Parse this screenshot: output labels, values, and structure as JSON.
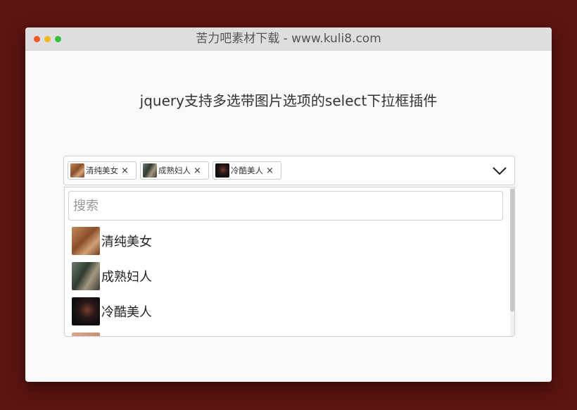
{
  "window": {
    "title": "苦力吧素材下载 - www.kuli8.com",
    "traffic_lights": {
      "close": "#f0592a",
      "minimize": "#f5b622",
      "zoom": "#35c13c"
    }
  },
  "page": {
    "heading": "jquery支持多选带图片选项的select下拉框插件"
  },
  "select": {
    "selected_tags": [
      {
        "label": "清纯美女",
        "remove": "×",
        "image": "portrait-warm-photo"
      },
      {
        "label": "成熟妇人",
        "remove": "×",
        "image": "portrait-green-photo"
      },
      {
        "label": "冷酷美人",
        "remove": "×",
        "image": "portrait-dark-photo"
      }
    ],
    "toggle_icon": "chevron-down-icon"
  },
  "dropdown": {
    "search_placeholder": "搜索",
    "options": [
      {
        "label": "清纯美女",
        "image": "portrait-warm-photo"
      },
      {
        "label": "成熟妇人",
        "image": "portrait-green-photo"
      },
      {
        "label": "冷酷美人",
        "image": "portrait-dark-photo"
      }
    ]
  },
  "colors": {
    "page_background": "#5c1410",
    "window_background": "#f9f9f9",
    "titlebar": "#dedede"
  }
}
